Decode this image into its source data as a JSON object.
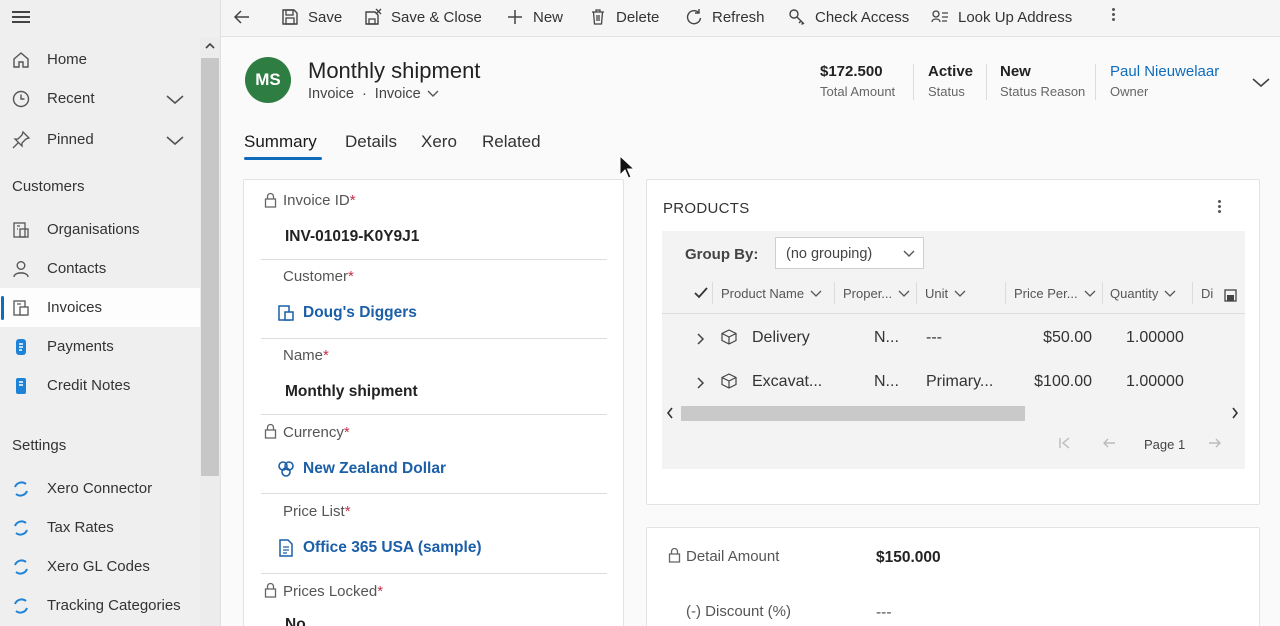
{
  "sidebar": {
    "items": [
      {
        "label": "Home",
        "icon": "home-icon"
      },
      {
        "label": "Recent",
        "icon": "clock-icon"
      },
      {
        "label": "Pinned",
        "icon": "pin-icon"
      }
    ],
    "sections": [
      {
        "title": "Customers",
        "items": [
          {
            "label": "Organisations",
            "icon": "organisation-icon"
          },
          {
            "label": "Contacts",
            "icon": "person-icon"
          },
          {
            "label": "Invoices",
            "icon": "invoice-icon",
            "selected": true
          },
          {
            "label": "Payments",
            "icon": "payment-icon"
          },
          {
            "label": "Credit Notes",
            "icon": "credit-note-icon"
          }
        ]
      },
      {
        "title": "Settings",
        "items": [
          {
            "label": "Xero Connector",
            "icon": "sync-icon"
          },
          {
            "label": "Tax Rates",
            "icon": "sync-icon"
          },
          {
            "label": "Xero GL Codes",
            "icon": "sync-icon"
          },
          {
            "label": "Tracking Categories",
            "icon": "sync-icon"
          }
        ]
      }
    ]
  },
  "toolbar": {
    "save": "Save",
    "save_close": "Save & Close",
    "new": "New",
    "delete": "Delete",
    "refresh": "Refresh",
    "check_access": "Check Access",
    "look_up_address": "Look Up Address"
  },
  "record": {
    "initials": "MS",
    "title": "Monthly shipment",
    "entity": "Invoice",
    "form": "Invoice",
    "header_fields": [
      {
        "value": "$172.500",
        "label": "Total Amount"
      },
      {
        "value": "Active",
        "label": "Status"
      },
      {
        "value": "New",
        "label": "Status Reason"
      },
      {
        "value": "Paul Nieuwelaar",
        "label": "Owner"
      }
    ]
  },
  "tabs": [
    "Summary",
    "Details",
    "Xero",
    "Related"
  ],
  "form": {
    "invoice_id": {
      "label": "Invoice ID",
      "value": "INV-01019-K0Y9J1"
    },
    "customer": {
      "label": "Customer",
      "value": "Doug's Diggers"
    },
    "name": {
      "label": "Name",
      "value": "Monthly shipment"
    },
    "currency": {
      "label": "Currency",
      "value": "New Zealand Dollar"
    },
    "price_list": {
      "label": "Price List",
      "value": "Office 365 USA (sample)"
    },
    "prices_locked": {
      "label": "Prices Locked",
      "value": "No"
    },
    "required_mark": "*"
  },
  "products": {
    "title": "PRODUCTS",
    "group_by_label": "Group By:",
    "group_by_value": "(no grouping)",
    "columns": [
      "Product Name",
      "Proper...",
      "Unit",
      "Price Per...",
      "Quantity",
      "Di"
    ],
    "rows": [
      {
        "name": "Delivery",
        "prop": "N...",
        "unit": "---",
        "price": "$50.00",
        "qty": "1.00000"
      },
      {
        "name": "Excavat...",
        "prop": "N...",
        "unit": "Primary...",
        "price": "$100.00",
        "qty": "1.00000"
      }
    ],
    "page_label": "Page 1"
  },
  "amounts": {
    "detail_label": "Detail Amount",
    "detail_value": "$150.000",
    "discount_label": "(-) Discount (%)",
    "discount_value": "---"
  }
}
